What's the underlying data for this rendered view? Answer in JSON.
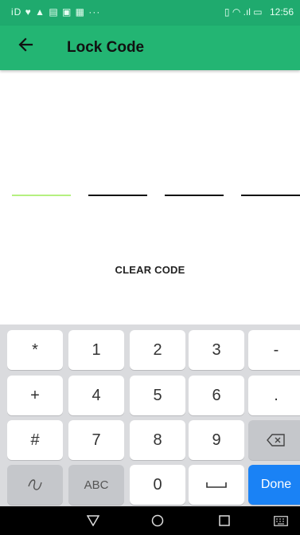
{
  "status_bar": {
    "left_icons": "iD ♥ ▲ ▤ ▣ ▦ ···",
    "right_icons": "▯ ◠ .ıl ▭",
    "time": "12:56"
  },
  "app_bar": {
    "title": "Lock Code"
  },
  "code_entry": {
    "slots": 4,
    "active_slot": 0
  },
  "clear_button": {
    "label": "CLEAR CODE"
  },
  "keyboard": {
    "rows": [
      [
        "*",
        "1",
        "2",
        "3",
        "-"
      ],
      [
        "+",
        "4",
        "5",
        "6",
        "."
      ],
      [
        "#",
        "7",
        "8",
        "9",
        ""
      ],
      [
        "",
        "ABC",
        "0",
        "",
        "Done"
      ]
    ]
  },
  "colors": {
    "status_bar": "#1faa6e",
    "app_bar": "#23b573",
    "active_underline": "#b5f080",
    "done_key": "#1a82f5"
  },
  "icons": [
    "back-arrow-icon",
    "backspace-icon",
    "gesture-icon",
    "space-icon",
    "nav-back-icon",
    "nav-home-icon",
    "nav-recents-icon",
    "keyboard-icon"
  ]
}
